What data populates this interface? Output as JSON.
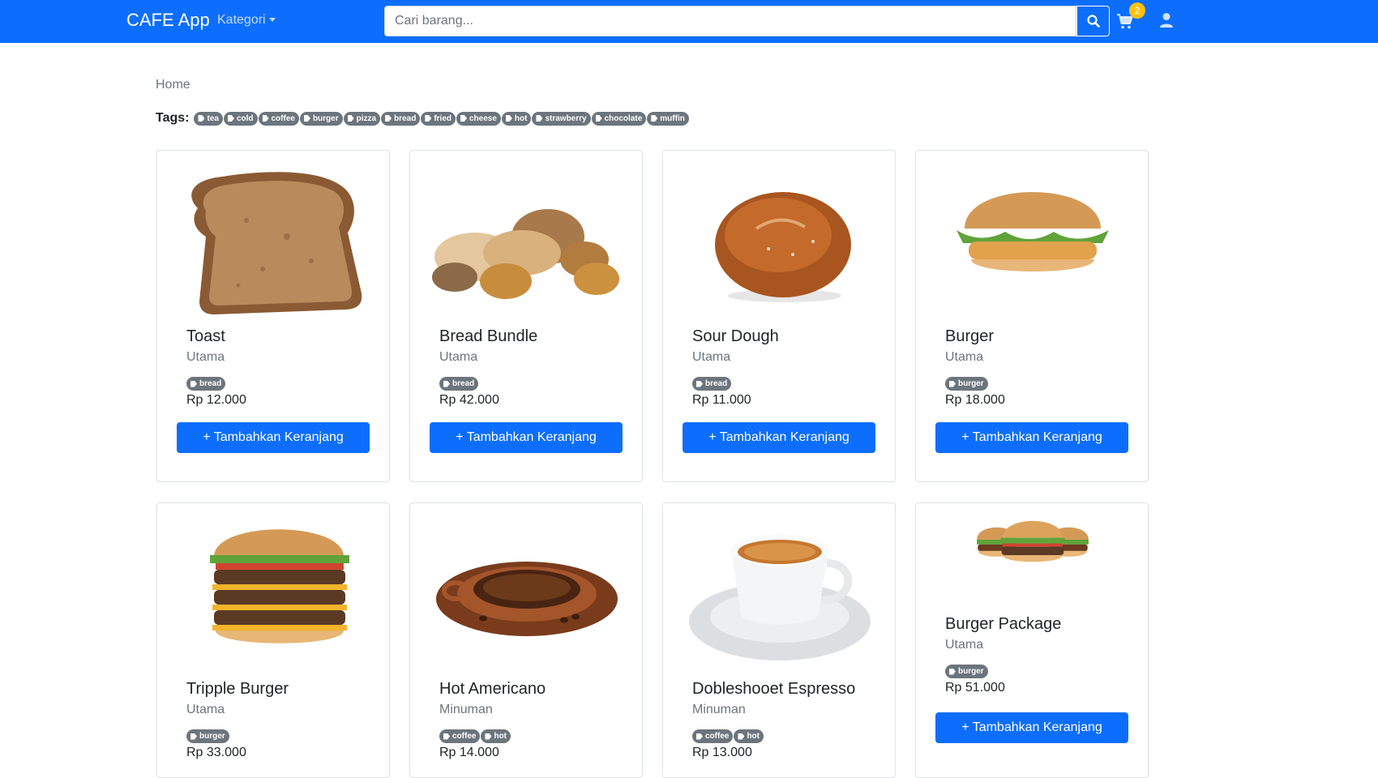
{
  "navbar": {
    "brand": "CAFE App",
    "kategori": "Kategori",
    "search_placeholder": "Cari barang...",
    "cart_count": "2",
    "icons": [
      "search-icon",
      "cart-icon",
      "user-icon"
    ]
  },
  "breadcrumb": "Home",
  "tags_label": "Tags:",
  "tags": [
    "tea",
    "cold",
    "coffee",
    "burger",
    "pizza",
    "bread",
    "fried",
    "cheese",
    "hot",
    "strawberry",
    "chocolate",
    "muffin"
  ],
  "add_button_label": "+ Tambahkan Keranjang",
  "products": [
    {
      "name": "Toast",
      "category": "Utama",
      "tags": [
        "bread"
      ],
      "price": "Rp 12.000"
    },
    {
      "name": "Bread Bundle",
      "category": "Utama",
      "tags": [
        "bread"
      ],
      "price": "Rp 42.000"
    },
    {
      "name": "Sour Dough",
      "category": "Utama",
      "tags": [
        "bread"
      ],
      "price": "Rp 11.000"
    },
    {
      "name": "Burger",
      "category": "Utama",
      "tags": [
        "burger"
      ],
      "price": "Rp 18.000"
    },
    {
      "name": "Tripple Burger",
      "category": "Utama",
      "tags": [
        "burger"
      ],
      "price": "Rp 33.000"
    },
    {
      "name": "Hot Americano",
      "category": "Minuman",
      "tags": [
        "coffee",
        "hot"
      ],
      "price": "Rp 14.000"
    },
    {
      "name": "Dobleshooet Espresso",
      "category": "Minuman",
      "tags": [
        "coffee",
        "hot"
      ],
      "price": "Rp 13.000"
    },
    {
      "name": "Burger Package",
      "category": "Utama",
      "tags": [
        "burger"
      ],
      "price": "Rp 51.000"
    }
  ],
  "colors": {
    "primary": "#0d6efd",
    "badge": "#ffc107",
    "tag": "#6c757d"
  }
}
